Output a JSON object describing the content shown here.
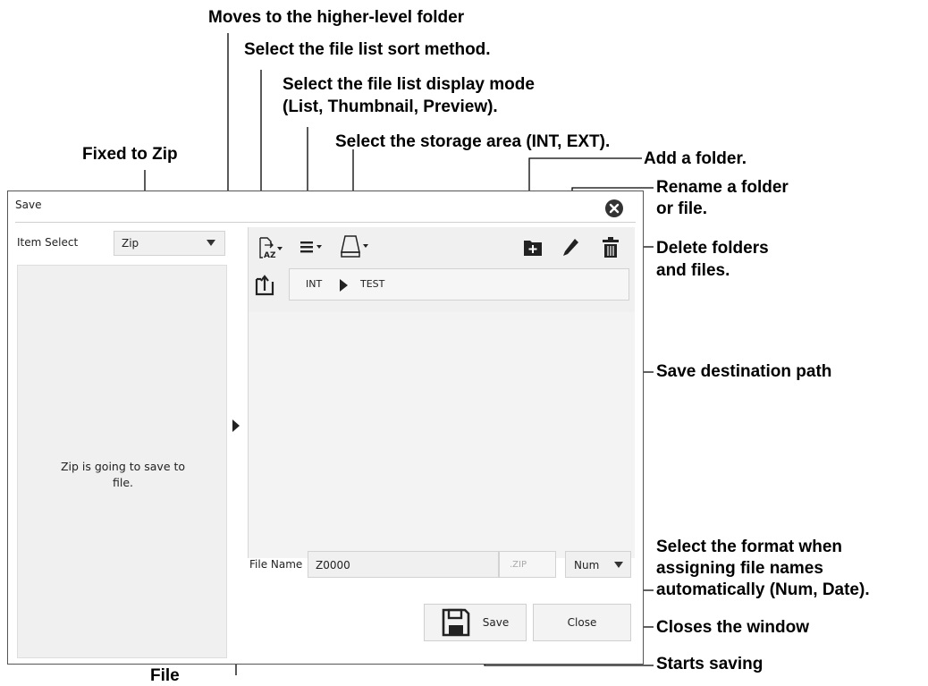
{
  "annotations": {
    "higher_folder": "Moves to the higher-level folder",
    "sort_method": "Select the file list sort method.",
    "display_mode_1": "Select the file list display mode",
    "display_mode_2": "(List, Thumbnail, Preview).",
    "storage_area": "Select the storage area (INT, EXT).",
    "fixed_zip": "Fixed to Zip",
    "add_folder": "Add a folder.",
    "rename_1": "Rename a folder",
    "rename_2": "or file.",
    "delete_1": "Delete folders",
    "delete_2": "and files.",
    "save_dest": "Save destination path",
    "format_1": "Select the format when",
    "format_2": "assigning file names",
    "format_3": "automatically (Num, Date).",
    "close_window": "Closes the window",
    "starts_saving": "Starts saving",
    "file_name_partial": "File"
  },
  "window": {
    "title": "Save",
    "item_select_label": "Item Select",
    "item_select_value": "Zip",
    "left_message": "Zip is going to save to file.",
    "path": [
      "INT",
      "TEST"
    ],
    "file_name_label": "File Name",
    "file_name_value": "Z0000",
    "extension": ".ZIP",
    "format_value": "Num",
    "save_label": "Save",
    "close_label": "Close"
  },
  "icons": [
    "sort-icon",
    "display-mode-icon",
    "storage-icon",
    "add-folder-icon",
    "rename-icon",
    "delete-icon",
    "folder-up-icon",
    "close-icon",
    "save-disk-icon",
    "expand-arrow-icon"
  ]
}
